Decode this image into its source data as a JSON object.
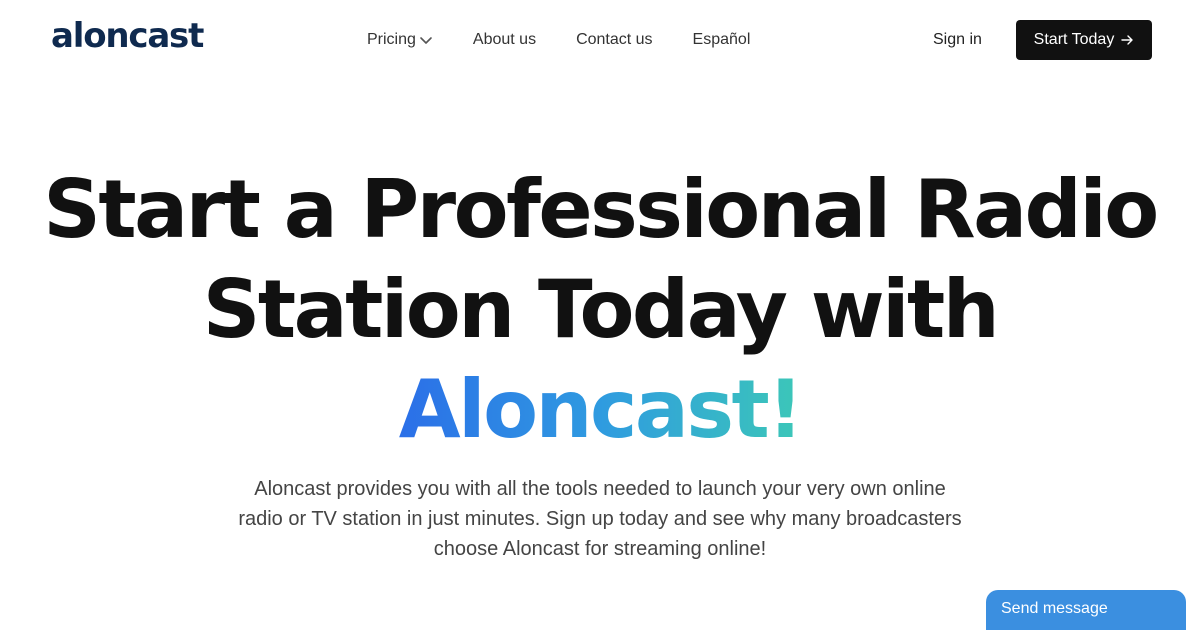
{
  "header": {
    "logo_text": "aloncast",
    "nav": [
      {
        "label": "Pricing",
        "icon": "chevron-down-icon"
      },
      {
        "label": "About us"
      },
      {
        "label": "Contact us"
      },
      {
        "label": "Español"
      }
    ],
    "signin_label": "Sign in",
    "cta_label": "Start Today",
    "cta_icon": "arrow-right-icon"
  },
  "hero": {
    "title_line1": "Start a Professional Radio",
    "title_line2": "Station Today with",
    "title_highlight": "Aloncast!",
    "subtitle_line1": "Aloncast provides you with all the tools needed to launch your very own online",
    "subtitle_line2": "radio or TV station in just minutes. Sign up today and see why many broadcasters",
    "subtitle_line3": "choose Aloncast for streaming online!"
  },
  "chat_widget": {
    "label": "Send message"
  },
  "colors": {
    "logo": "#0f2a4f",
    "cta_bg": "#111111",
    "gradient_start": "#2b6fe8",
    "gradient_end": "#3cc7b8",
    "chat_bg": "#3b8fe0"
  }
}
